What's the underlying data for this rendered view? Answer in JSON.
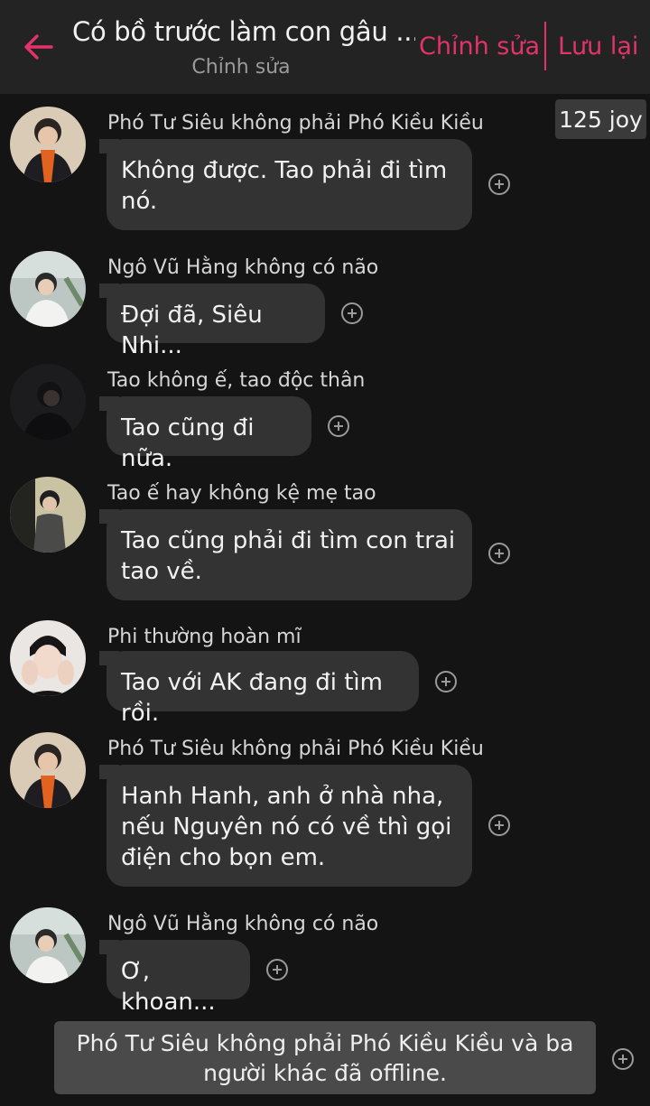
{
  "header": {
    "title": "Có bồ trước làm con gâu ...",
    "subtitle": "Chỉnh sửa",
    "edit_label": "Chỉnh sửa",
    "save_label": "Lưu lại",
    "accent_color": "#e2336b"
  },
  "joy_badge": "125 joy",
  "messages": [
    {
      "sender": "Phó Tư Siêu không phải Phó Kiều Kiều",
      "text": "Không được. Tao phải đi tìm\nnó.",
      "avatar": "avatar-orange-scarf"
    },
    {
      "sender": "Ngô Vũ Hằng không có não",
      "text": "Đợi đã, Siêu Nhi...",
      "avatar": "avatar-white-shirt"
    },
    {
      "sender": "Tao không ế, tao độc thân",
      "text": "Tao cũng đi nữa.",
      "avatar": "avatar-dark"
    },
    {
      "sender": "Tao ế hay không kệ mẹ tao",
      "text": "Tao cũng phải đi tìm con trai\ntao về.",
      "avatar": "avatar-suit"
    },
    {
      "sender": "Phi thường hoàn mĩ",
      "text": "Tao với AK đang đi tìm rồi.",
      "avatar": "avatar-hands-face"
    },
    {
      "sender": "Phó Tư Siêu không phải Phó Kiều Kiều",
      "text": "Hanh Hanh, anh ở nhà nha,\nnếu Nguyên nó có về thì gọi\nđiện cho bọn em.",
      "avatar": "avatar-orange-scarf"
    },
    {
      "sender": "Ngô Vũ Hằng không có não",
      "text": "Ơ, khoan...",
      "avatar": "avatar-white-shirt"
    }
  ],
  "notice": "Phó Tư Siêu không phải Phó Kiều Kiều và ba\nngười khác đã offline."
}
